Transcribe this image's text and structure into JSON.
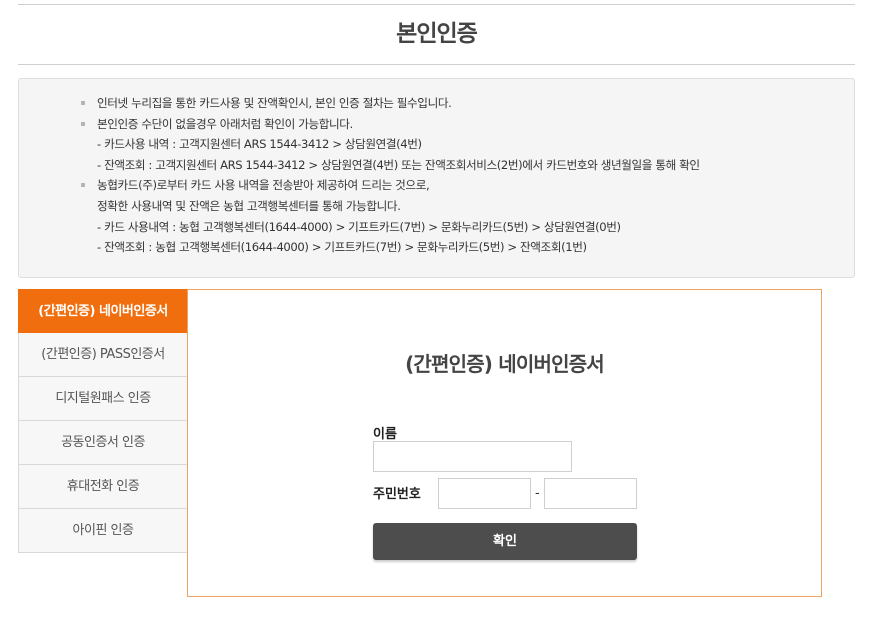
{
  "page": {
    "title": "본인인증"
  },
  "notice": {
    "lines": [
      {
        "text": "인터넷 누리집을 통한 카드사용 및 잔액확인시, 본인 인증 절차는 필수입니다.",
        "bullet": true
      },
      {
        "text": "본인인증 수단이 없을경우 아래처럼 확인이 가능합니다.",
        "bullet": true
      },
      {
        "text": "- 카드사용 내역 : 고객지원센터 ARS 1544-3412 > 상담원연결(4번)",
        "bullet": false
      },
      {
        "text": "- 잔액조회 : 고객지원센터 ARS 1544-3412 > 상담원연결(4번) 또는 잔액조회서비스(2번)에서 카드번호와 생년월일을 통해 확인",
        "bullet": false
      },
      {
        "text": "농협카드(주)로부터 카드 사용 내역을 전송받아 제공하여 드리는 것으로,",
        "bullet": true
      },
      {
        "text": "정확한 사용내역 및 잔액은 농협 고객행복센터를 통해 가능합니다.",
        "bullet": false
      },
      {
        "text": "- 카드 사용내역 : 농협 고객행복센터(1644-4000) > 기프트카드(7번) > 문화누리카드(5번) > 상담원연결(0번)",
        "bullet": false
      },
      {
        "text": "- 잔액조회 : 농협 고객행복센터(1644-4000) > 기프트카드(7번) > 문화누리카드(5번) > 잔액조회(1번)",
        "bullet": false
      }
    ]
  },
  "tabs": [
    {
      "label": "(간편인증) 네이버인증서",
      "active": true
    },
    {
      "label": "(간편인증) PASS인증서",
      "active": false
    },
    {
      "label": "디지털원패스 인증",
      "active": false
    },
    {
      "label": "공동인증서 인증",
      "active": false
    },
    {
      "label": "휴대전화 인증",
      "active": false
    },
    {
      "label": "아이핀 인증",
      "active": false
    }
  ],
  "form": {
    "title": "(간편인증) 네이버인증서",
    "name_label": "이름",
    "name_value": "",
    "rrn_label": "주민번호",
    "rrn_first_value": "",
    "rrn_separator": "-",
    "rrn_second_value": "",
    "confirm_label": "확인"
  },
  "colors": {
    "accent": "#f16e0e",
    "panel_border": "#f0a260",
    "button_bg": "#4d4d4d",
    "notice_bg": "#f5f5f5"
  }
}
